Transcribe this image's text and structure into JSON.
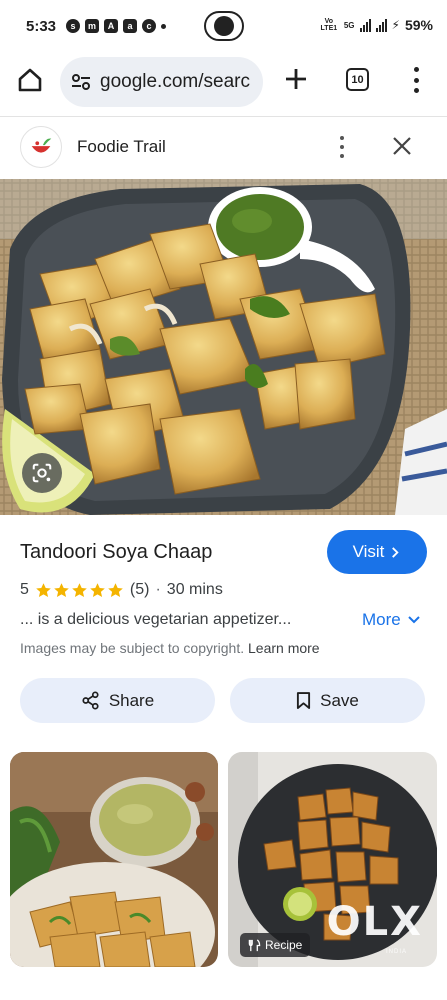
{
  "status_bar": {
    "time": "5:33",
    "network_label": "Vo LTE1",
    "signal_label": "5G",
    "battery": "59%"
  },
  "browser": {
    "url": "google.com/searc",
    "tab_count": "10"
  },
  "site": {
    "name": "Foodie Trail"
  },
  "recipe": {
    "title": "Tandoori Soya Chaap",
    "visit_label": "Visit",
    "rating_value": "5",
    "stars": 5,
    "review_count": "(5)",
    "separator": "·",
    "duration": "30 mins",
    "description": "... is a delicious vegetarian appetizer...",
    "more_label": "More",
    "copyright_text": "Images may be subject to copyright.",
    "learn_more_label": "Learn more",
    "share_label": "Share",
    "save_label": "Save"
  },
  "related": {
    "chip_label": "Recipe",
    "watermark": "OLX",
    "watermark_sub": "INDIA"
  },
  "colors": {
    "accent": "#1a73e8",
    "star": "#f4b400",
    "chip_bg": "#e8eefa"
  }
}
